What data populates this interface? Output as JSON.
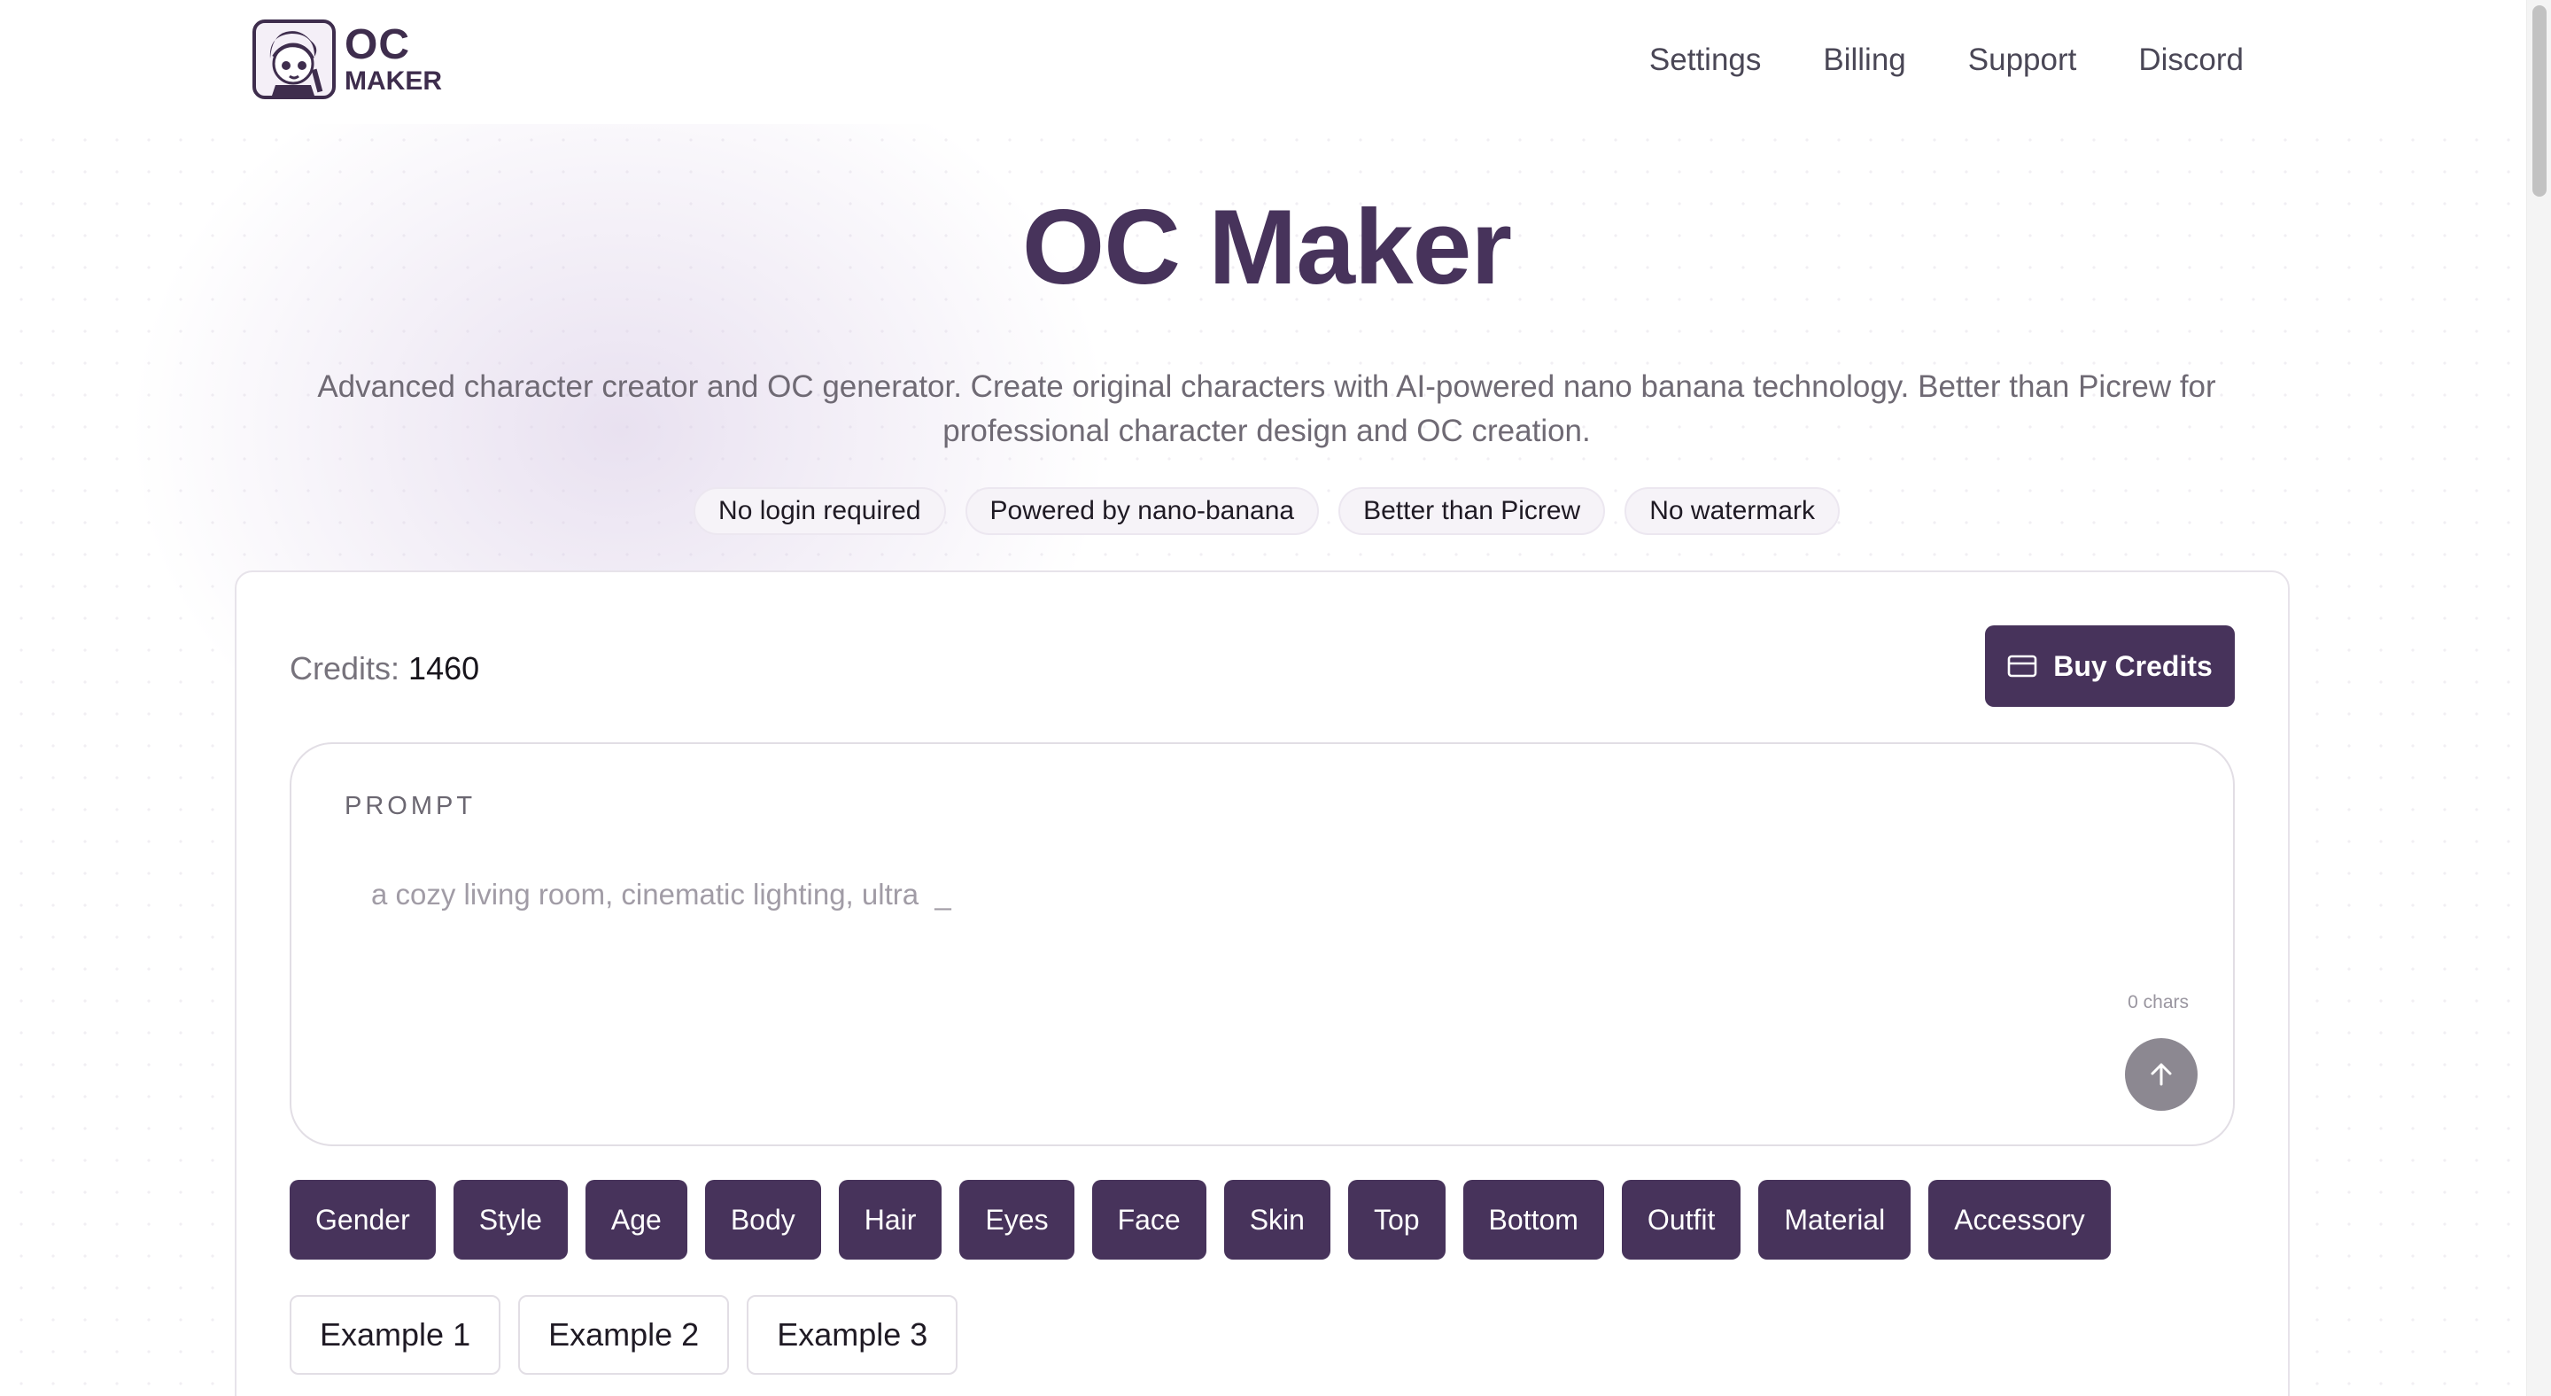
{
  "header": {
    "logo_line1": "OC",
    "logo_line2": "MAKER",
    "nav": [
      "Settings",
      "Billing",
      "Support",
      "Discord"
    ]
  },
  "hero": {
    "title": "OC Maker",
    "description": "Advanced character creator and OC generator. Create original characters with AI-powered nano banana technology. Better than Picrew for professional character design and OC creation.",
    "badges": [
      "No login required",
      "Powered by nano-banana",
      "Better than Picrew",
      "No watermark"
    ]
  },
  "card": {
    "credits_label": "Credits:",
    "credits_value": "1460",
    "buy_label": "Buy Credits",
    "prompt_label": "PROMPT",
    "prompt_placeholder": "a cozy living room, cinematic lighting, ultra  _",
    "prompt_value": "",
    "char_count": "0 chars",
    "tags": [
      "Gender",
      "Style",
      "Age",
      "Body",
      "Hair",
      "Eyes",
      "Face",
      "Skin",
      "Top",
      "Bottom",
      "Outfit",
      "Material",
      "Accessory"
    ],
    "examples": [
      "Example 1",
      "Example 2",
      "Example 3"
    ]
  },
  "icons": {
    "logo": "character-face-icon",
    "buy": "credit-card-icon",
    "submit": "arrow-up-icon"
  },
  "colors": {
    "accent": "#47335b",
    "submit_disabled": "#8c8891"
  }
}
